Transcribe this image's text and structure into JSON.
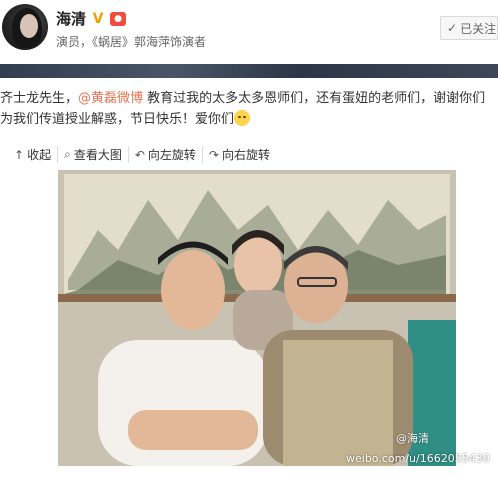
{
  "profile": {
    "name": "海清",
    "subtitle": "演员，《蜗居》郭海萍饰演者",
    "follow_label": "已关注",
    "vip_icon": "v-badge-icon",
    "badge_icon": "weibo-badge-icon"
  },
  "post": {
    "text_before": "齐士龙先生，",
    "mention": "@黄磊微博",
    "text_after": " 教育过我的太多太多恩师们，还有蛋妞的老师们，谢谢你们为我们传道授业解惑，节日快乐！爱你们",
    "emoji": "smile-face-icon"
  },
  "toolbar": {
    "collapse": "收起",
    "view_large": "查看大图",
    "rotate_left": "向左旋转",
    "rotate_right": "向右旋转"
  },
  "photo": {
    "watermark_name": "@海清",
    "watermark_url": "weibo.com/u/1662055430"
  },
  "colors": {
    "mention": "#eb7350",
    "follow_bg": "#f7f7f7",
    "banner": "#323d4f"
  }
}
